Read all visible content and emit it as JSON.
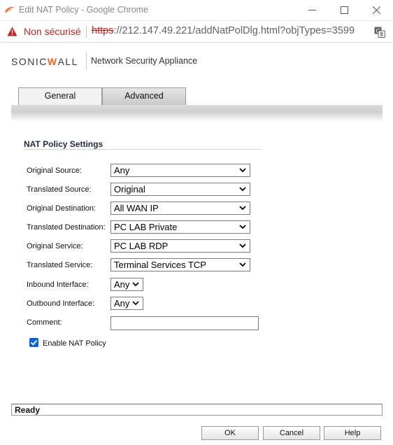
{
  "window": {
    "title": "Edit NAT Policy - Google Chrome"
  },
  "addressbar": {
    "security_label": "Non sécurisé",
    "url_scheme": "https",
    "url_rest": "://212.147.49.221/addNatPolDlg.html?objTypes=3599"
  },
  "brand": {
    "logo_prefix": "SONIC",
    "logo_w": "W",
    "logo_suffix": "ALL",
    "product": "Network Security Appliance"
  },
  "tabs": [
    {
      "label": "General",
      "active": true
    },
    {
      "label": "Advanced",
      "active": false
    }
  ],
  "form": {
    "section_title": "NAT Policy Settings",
    "fields": [
      {
        "label": "Original Source:",
        "value": "Any"
      },
      {
        "label": "Translated Source:",
        "value": "Original"
      },
      {
        "label": "Original Destination:",
        "value": "All WAN IP"
      },
      {
        "label": "Translated Destination:",
        "value": "PC LAB Private"
      },
      {
        "label": "Original Service:",
        "value": "PC LAB RDP"
      },
      {
        "label": "Translated Service:",
        "value": "Terminal Services TCP"
      },
      {
        "label": "Inbound Interface:",
        "value": "Any"
      },
      {
        "label": "Outbound Interface:",
        "value": "Any"
      },
      {
        "label": "Comment:",
        "value": ""
      }
    ],
    "enable_label": "Enable NAT Policy",
    "enable_checked": true
  },
  "status": {
    "text": "Ready"
  },
  "buttons": {
    "ok": "OK",
    "cancel": "Cancel",
    "help": "Help"
  },
  "colors": {
    "insecure_red": "#c5221f",
    "brand_orange": "#f26522",
    "checkbox_blue": "#0b63d6"
  },
  "icons": {
    "app": "chrome-app-icon",
    "warning": "warning-triangle-icon",
    "translate": "translate-icon",
    "caret": "chevron-down-icon",
    "check": "checkmark-icon"
  }
}
